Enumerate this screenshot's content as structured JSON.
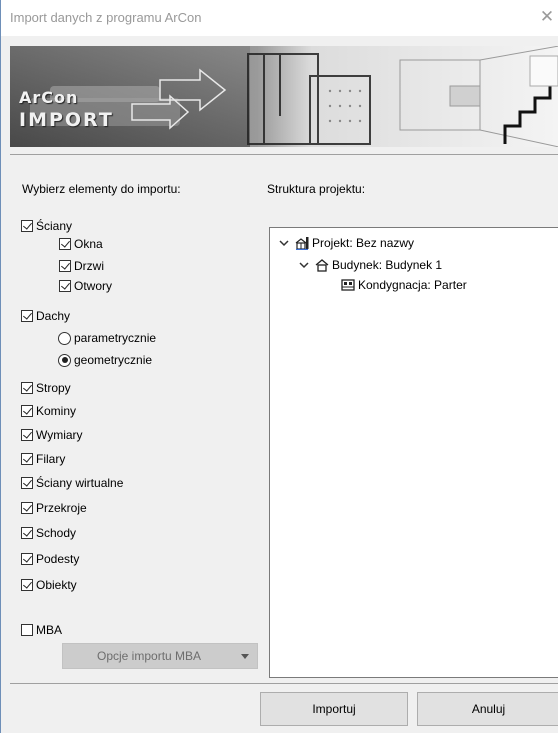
{
  "window": {
    "title": "Import danych z programu ArCon",
    "close_glyph": "✕"
  },
  "banner": {
    "logo_line1": "ArCon",
    "logo_line2": "IMPORT"
  },
  "left_panel": {
    "heading": "Wybierz elementy do importu:",
    "walls": {
      "label": "Ściany",
      "checked": true,
      "children": [
        {
          "label": "Okna",
          "checked": true
        },
        {
          "label": "Drzwi",
          "checked": true
        },
        {
          "label": "Otwory",
          "checked": true
        }
      ]
    },
    "roofs": {
      "label": "Dachy",
      "checked": true,
      "options": [
        {
          "label": "parametrycznie",
          "selected": false
        },
        {
          "label": "geometrycznie",
          "selected": true
        }
      ]
    },
    "items": [
      {
        "label": "Stropy",
        "checked": true
      },
      {
        "label": "Kominy",
        "checked": true
      },
      {
        "label": "Wymiary",
        "checked": true
      },
      {
        "label": "Filary",
        "checked": true
      },
      {
        "label": "Ściany wirtualne",
        "checked": true
      },
      {
        "label": "Przekroje",
        "checked": true
      },
      {
        "label": "Schody",
        "checked": true
      },
      {
        "label": "Podesty",
        "checked": true
      },
      {
        "label": "Obiekty",
        "checked": true
      }
    ],
    "mba": {
      "label": "MBA",
      "checked": false
    },
    "mba_options": {
      "label": "Opcje importu MBA",
      "disabled": true
    }
  },
  "right_panel": {
    "heading": "Struktura projektu:",
    "tree": [
      {
        "label": "Projekt: Bez nazwy",
        "icon": "project-icon",
        "expanded": true
      },
      {
        "label": "Budynek: Budynek 1",
        "icon": "building-icon",
        "expanded": true
      },
      {
        "label": "Kondygnacja: Parter",
        "icon": "floor-icon"
      }
    ]
  },
  "buttons": {
    "import": "Importuj",
    "cancel": "Anuluj"
  }
}
